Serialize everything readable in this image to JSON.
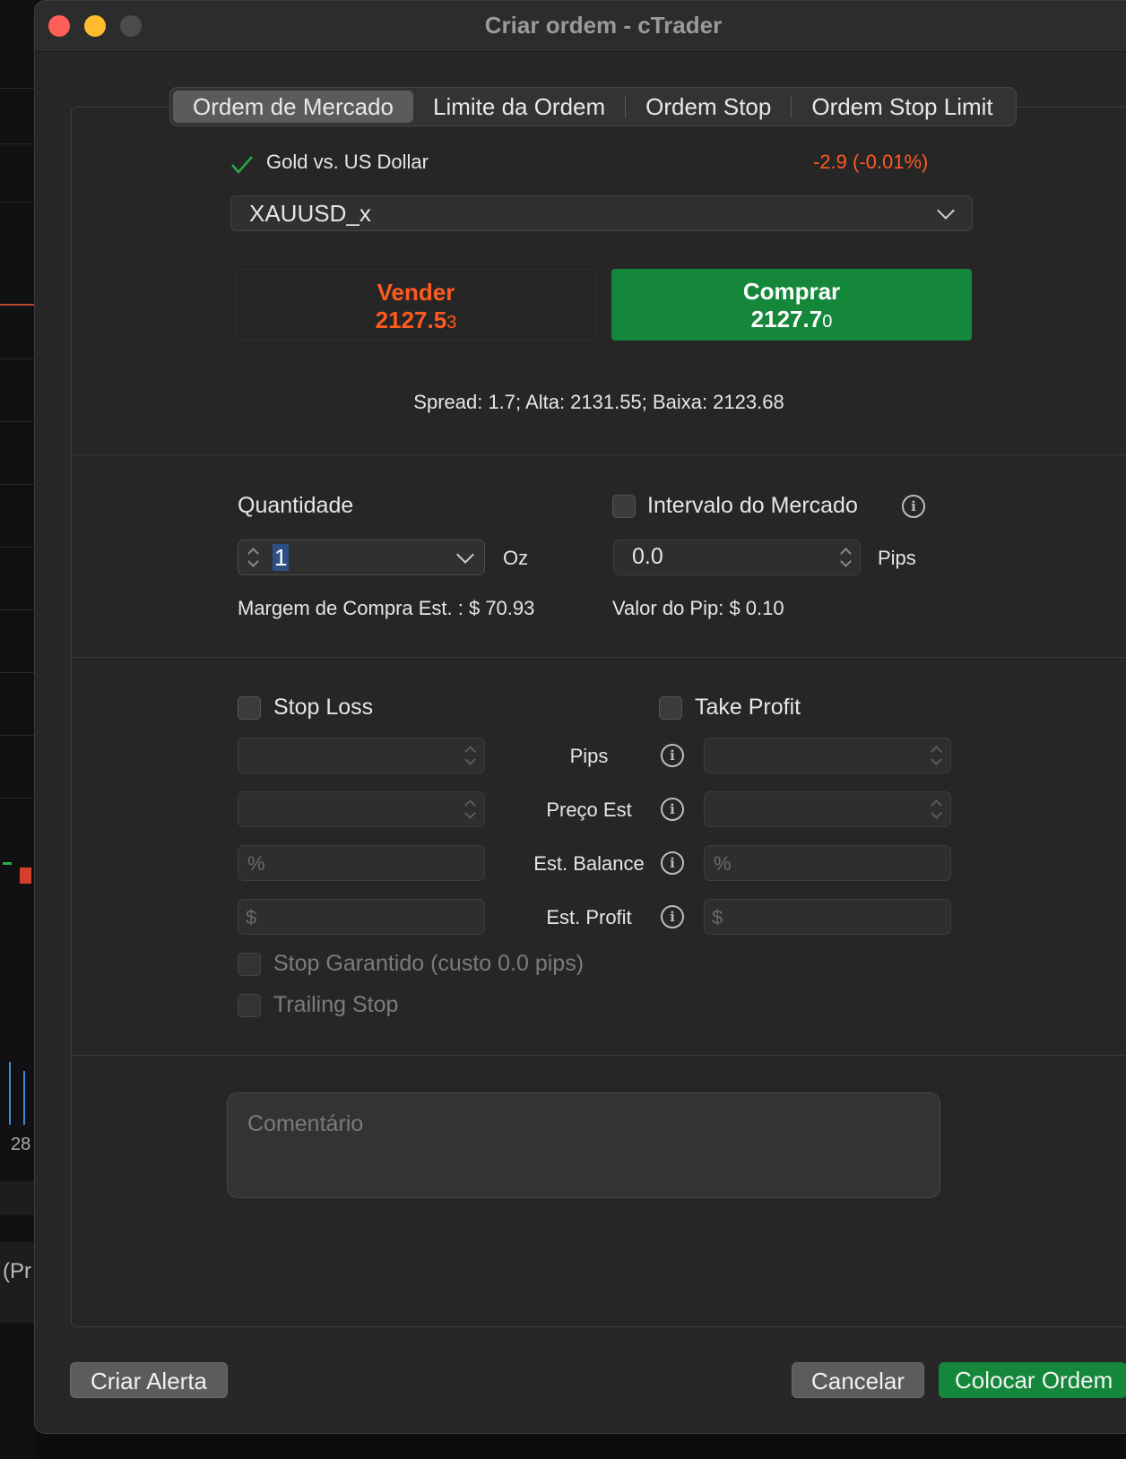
{
  "window": {
    "title": "Criar ordem - cTrader"
  },
  "tabs": [
    {
      "label": "Ordem de Mercado",
      "active": true
    },
    {
      "label": "Limite da Ordem",
      "active": false
    },
    {
      "label": "Ordem Stop",
      "active": false
    },
    {
      "label": "Ordem Stop Limit",
      "active": false
    }
  ],
  "symbol": {
    "name": "Gold vs. US Dollar",
    "change": "-2.9 (-0.01%)",
    "selected": "XAUUSD_x",
    "status_icon": "checkmark-icon"
  },
  "sell": {
    "label": "Vender",
    "price_main": "2127.5",
    "price_pip": "3"
  },
  "buy": {
    "label": "Comprar",
    "price_main": "2127.7",
    "price_pip": "0"
  },
  "market_info": "Spread: 1.7; Alta: 2131.55; Baixa: 2123.68",
  "quantity": {
    "label": "Quantidade",
    "value": "1",
    "unit": "Oz",
    "margin_text": "Margem de Compra Est. : $ 70.93"
  },
  "market_range": {
    "label": "Intervalo do Mercado",
    "value": "0.0",
    "unit": "Pips",
    "pip_value_text": "Valor do Pip: $ 0.10"
  },
  "protection": {
    "stop_loss_label": "Stop Loss",
    "take_profit_label": "Take Profit",
    "rows": [
      {
        "label": "Pips",
        "placeholder": ""
      },
      {
        "label": "Preço Est",
        "placeholder": ""
      },
      {
        "label": "Est. Balance",
        "placeholder": "%"
      },
      {
        "label": "Est. Profit",
        "placeholder": "$"
      }
    ],
    "guaranteed_stop_label": "Stop Garantido (custo 0.0 pips)",
    "trailing_stop_label": "Trailing Stop"
  },
  "comment": {
    "placeholder": "Comentário"
  },
  "footer": {
    "alert_button": "Criar Alerta",
    "cancel_button": "Cancelar",
    "place_button": "Colocar Ordem"
  },
  "background": {
    "axis_label": "28",
    "panel_fragment": "(Pr"
  },
  "colors": {
    "sell": "#ff5a1f",
    "buy": "#15873a",
    "negative_change": "#ff5a1f",
    "check": "#2ea84a"
  }
}
